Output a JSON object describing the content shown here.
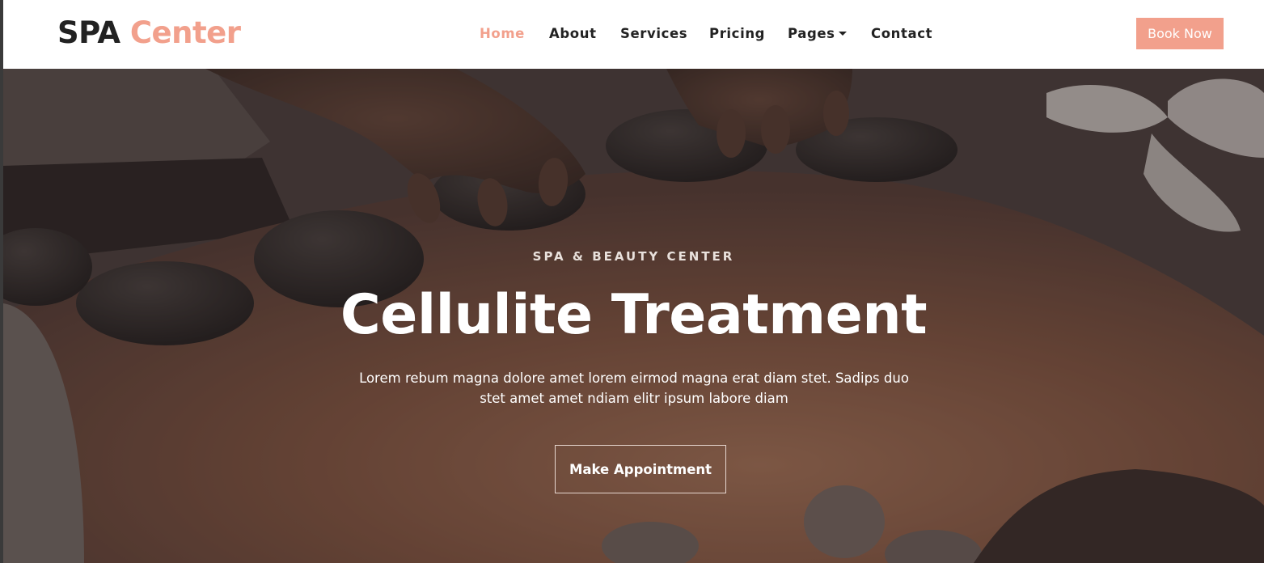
{
  "brand": {
    "part1": "SPA",
    "part2": "Center"
  },
  "nav": {
    "items": [
      {
        "label": "Home",
        "active": true
      },
      {
        "label": "About",
        "active": false
      },
      {
        "label": "Services",
        "active": false
      },
      {
        "label": "Pricing",
        "active": false
      },
      {
        "label": "Pages",
        "active": false,
        "dropdown": true
      },
      {
        "label": "Contact",
        "active": false
      }
    ],
    "book_label": "Book Now"
  },
  "hero": {
    "kicker": "SPA & BEAUTY CENTER",
    "title": "Cellulite Treatment",
    "description": "Lorem rebum magna dolore amet lorem eirmod magna erat diam stet. Sadips duo stet amet amet ndiam elitr ipsum labore diam",
    "cta_label": "Make Appointment"
  },
  "colors": {
    "accent": "#f2a08c",
    "dark_text": "#222222",
    "header_bg": "#ffffff"
  },
  "icons": {
    "pages_dropdown": "caret-down-icon"
  }
}
